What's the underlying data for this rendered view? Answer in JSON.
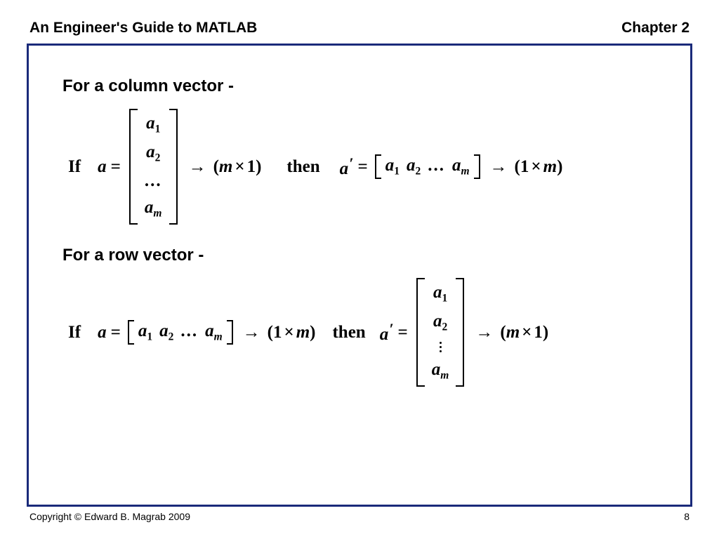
{
  "header": {
    "title": "An Engineer's Guide to MATLAB",
    "chapter": "Chapter 2"
  },
  "footer": {
    "copyright": "Copyright © Edward B. Magrab 2009",
    "page": "8"
  },
  "sec1": {
    "heading": "For a column vector -"
  },
  "sec2": {
    "heading": "For a row vector -"
  },
  "sym": {
    "if": "If",
    "then": "then",
    "a": "a",
    "aprime": "a′",
    "eq": "=",
    "arrow": "→",
    "dim_m1": "(m × 1)",
    "dim_1m": "(1 × m)",
    "a1": "a",
    "a2": "a",
    "am": "a",
    "sub1": "1",
    "sub2": "2",
    "subm": "m",
    "dots": "...",
    "m": "m",
    "one": "1",
    "lp": "(",
    "rp": ")",
    "times": "×"
  }
}
